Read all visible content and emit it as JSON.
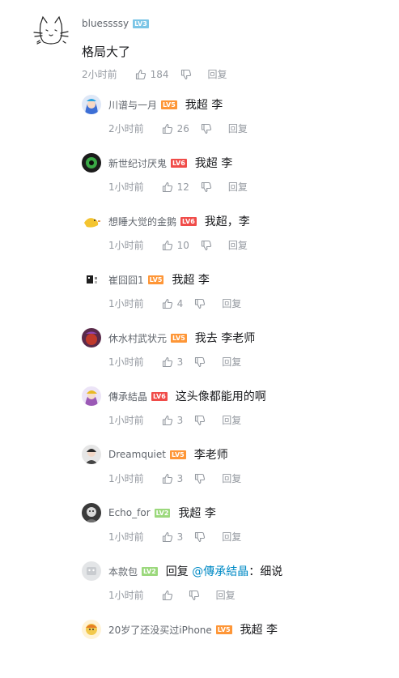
{
  "main": {
    "username": "bluessssy",
    "level": "LV3",
    "content": "格局大了",
    "time": "2小时前",
    "likes": "184",
    "reply_label": "回复"
  },
  "replies": [
    {
      "username": "川谱与一月",
      "level": "LV5",
      "text": "我超 李",
      "time": "2小时前",
      "likes": "26",
      "reply_label": "回复"
    },
    {
      "username": "新世纪讨厌鬼",
      "level": "LV6",
      "text": "我超 李",
      "time": "1小时前",
      "likes": "12",
      "reply_label": "回复"
    },
    {
      "username": "想睡大觉的金鹅",
      "level": "LV6",
      "text": "我超，李",
      "time": "1小时前",
      "likes": "10",
      "reply_label": "回复"
    },
    {
      "username": "崔囧囧1",
      "level": "LV5",
      "text": "我超 李",
      "time": "1小时前",
      "likes": "4",
      "reply_label": "回复"
    },
    {
      "username": "休水村武状元",
      "level": "LV5",
      "text": "我去 李老师",
      "time": "1小时前",
      "likes": "3",
      "reply_label": "回复"
    },
    {
      "username": "傳承結晶",
      "level": "LV6",
      "text": "这头像都能用的啊",
      "time": "1小时前",
      "likes": "3",
      "reply_label": "回复"
    },
    {
      "username": "Dreamquiet",
      "level": "LV5",
      "text": "李老师",
      "time": "1小时前",
      "likes": "3",
      "reply_label": "回复"
    },
    {
      "username": "Echo_for",
      "level": "LV2",
      "text": "我超 李",
      "time": "1小时前",
      "likes": "3",
      "reply_label": "回复"
    },
    {
      "username": "本款包",
      "level": "LV2",
      "text_prefix": "回复",
      "mention": "@傳承結晶",
      "text_suffix": "：细说",
      "time": "1小时前",
      "likes": "",
      "reply_label": "回复"
    },
    {
      "username": "20岁了还没买过iPhone",
      "level": "LV5",
      "text": "我超 李",
      "time": "",
      "likes": "",
      "reply_label": ""
    }
  ]
}
